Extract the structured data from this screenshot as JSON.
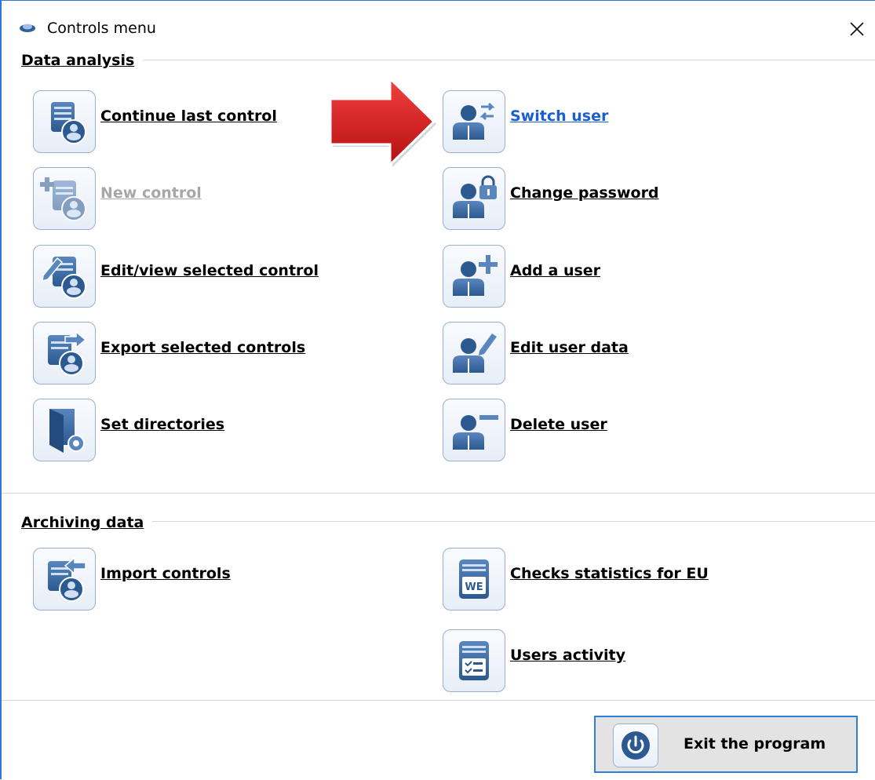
{
  "window": {
    "title": "Controls menu",
    "close_icon": "close-icon"
  },
  "sections": {
    "data_analysis": {
      "title": "Data analysis"
    },
    "archiving": {
      "title": "Archiving data"
    }
  },
  "left_items": [
    {
      "label": "Continue last control",
      "icon": "control-document-icon",
      "state": "normal"
    },
    {
      "label": "New control",
      "icon": "new-control-icon",
      "state": "disabled"
    },
    {
      "label": "Edit/view selected control",
      "icon": "edit-control-icon",
      "state": "normal"
    },
    {
      "label": "Export selected controls",
      "icon": "export-controls-icon",
      "state": "normal"
    },
    {
      "label": "Set directories",
      "icon": "set-directories-icon",
      "state": "normal"
    }
  ],
  "right_items": [
    {
      "label": "Switch user",
      "icon": "switch-user-icon",
      "state": "link"
    },
    {
      "label": "Change password",
      "icon": "change-password-icon",
      "state": "normal"
    },
    {
      "label": "Add a user",
      "icon": "add-user-icon",
      "state": "normal"
    },
    {
      "label": "Edit user data",
      "icon": "edit-user-icon",
      "state": "normal"
    },
    {
      "label": "Delete user",
      "icon": "delete-user-icon",
      "state": "normal"
    }
  ],
  "archiving_items": [
    {
      "label": "Import controls",
      "icon": "import-controls-icon"
    },
    {
      "label": "Checks statistics for EU",
      "icon": "we-statistics-icon",
      "badge": "WE"
    },
    {
      "label": "Users activity",
      "icon": "users-activity-icon"
    }
  ],
  "exit": {
    "label": "Exit the program",
    "icon": "power-icon"
  },
  "colors": {
    "accent": "#2b79d4",
    "link": "#1a5fd0",
    "icon_blue": "#2e5f99",
    "arrow_red": "#d42020"
  }
}
